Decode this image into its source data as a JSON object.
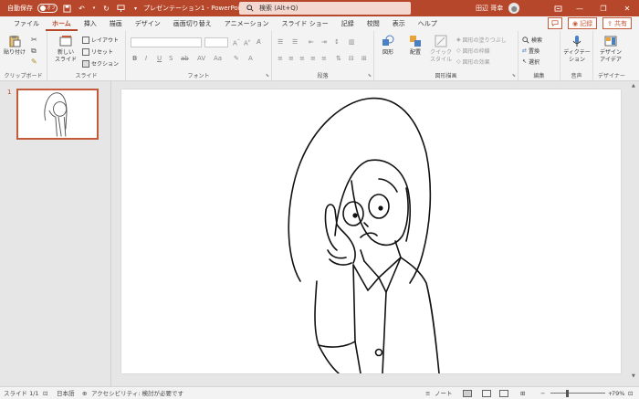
{
  "titlebar": {
    "autosave_label": "自動保存",
    "autosave_state": "オフ",
    "doc_title": "プレゼンテーション1 - PowerPoint",
    "search_placeholder": "検索 (Alt+Q)",
    "user_name": "田辺 哥幸"
  },
  "tabs": [
    "ファイル",
    "ホーム",
    "挿入",
    "描画",
    "デザイン",
    "画面切り替え",
    "アニメーション",
    "スライド ショー",
    "記録",
    "校閲",
    "表示",
    "ヘルプ"
  ],
  "active_tab": "ホーム",
  "tab_actions": {
    "record": "記録",
    "share": "共有"
  },
  "ribbon": {
    "clipboard": {
      "paste": "貼り付け",
      "label": "クリップボード"
    },
    "slides": {
      "new_slide_1": "新しい",
      "new_slide_2": "スライド",
      "layout": "レイアウト",
      "reset": "リセット",
      "section": "セクション",
      "label": "スライド"
    },
    "font": {
      "label": "フォント"
    },
    "paragraph": {
      "label": "段落"
    },
    "drawing": {
      "shape": "図形",
      "arrange": "配置",
      "quick_style_1": "クイック",
      "quick_style_2": "スタイル",
      "fill": "図形の塗りつぶし",
      "outline": "図形の枠線",
      "effects": "図形の効果",
      "label": "図形描画"
    },
    "editing": {
      "find": "検索",
      "replace": "置換",
      "select": "選択",
      "label": "編集"
    },
    "voice": {
      "dictate_1": "ディクテー",
      "dictate_2": "ション",
      "label": "音声"
    },
    "designer": {
      "idea_1": "デザイン",
      "idea_2": "アイデア",
      "label": "デザイナー"
    }
  },
  "thumbnail": {
    "number": "1"
  },
  "statusbar": {
    "slide": "スライド 1/1",
    "language": "日本語",
    "accessibility": "アクセシビリティ: 検討が必要です",
    "notes": "ノート",
    "zoom": "79%"
  },
  "colors": {
    "accent": "#b7472a",
    "ribbon_bg": "#f3f3f3",
    "canvas_bg": "#e6e6e6"
  }
}
